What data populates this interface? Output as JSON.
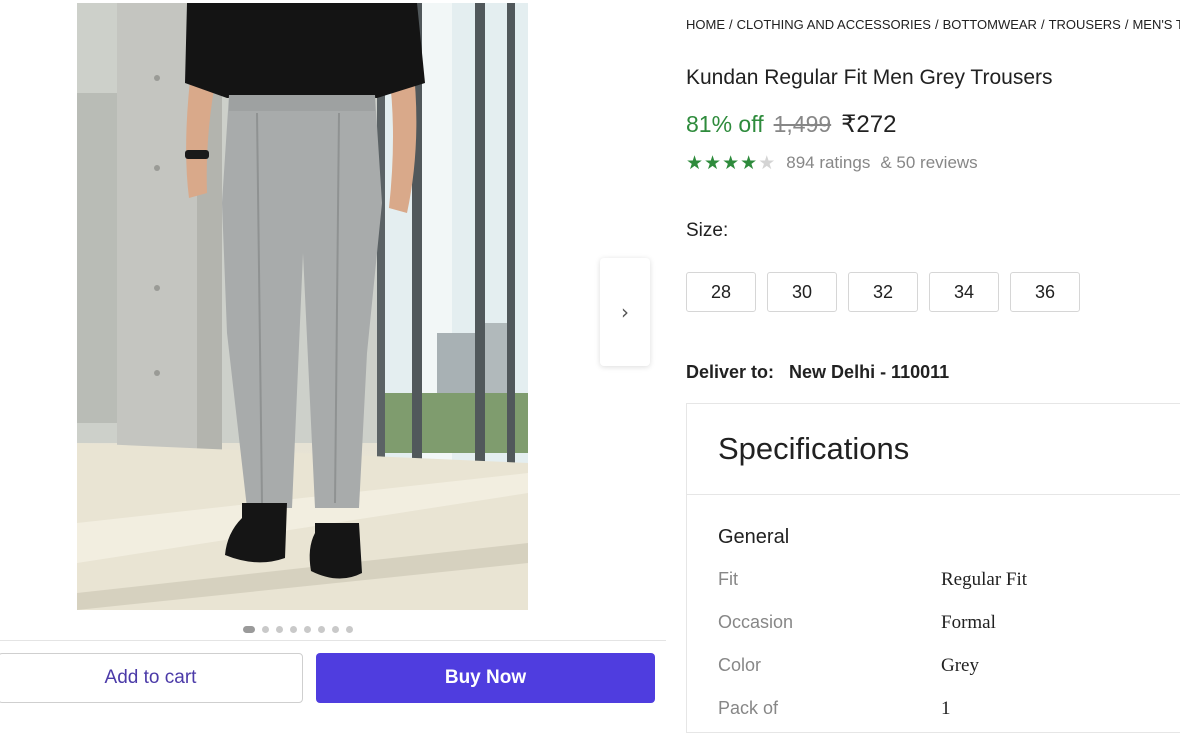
{
  "breadcrumb": [
    "HOME",
    "CLOTHING AND ACCESSORIES",
    "BOTTOMWEAR",
    "TROUSERS",
    "MEN'S TROUSERS"
  ],
  "breadcrumb_separator": "/",
  "product": {
    "title": "Kundan Regular Fit Men Grey Trousers",
    "discount": "81% off",
    "mrp": "1,499",
    "price": "₹272",
    "rating_stars": 4,
    "ratings_text": "894 ratings",
    "reviews_text": "& 50 reviews"
  },
  "image_carousel": {
    "total_dots": 8,
    "active_index": 0,
    "next_icon": "chevron-right-icon"
  },
  "size": {
    "label": "Size:",
    "options": [
      "28",
      "30",
      "32",
      "34",
      "36"
    ]
  },
  "delivery": {
    "label": "Deliver to:",
    "location": "New Delhi - 110011"
  },
  "specifications": {
    "title": "Specifications",
    "group": "General",
    "rows": [
      {
        "key": "Fit",
        "value": "Regular Fit"
      },
      {
        "key": "Occasion",
        "value": "Formal"
      },
      {
        "key": "Color",
        "value": "Grey"
      },
      {
        "key": "Pack of",
        "value": "1"
      }
    ]
  },
  "actions": {
    "add_to_cart": "Add to cart",
    "buy_now": "Buy Now"
  },
  "colors": {
    "discount_green": "#2e8b3c",
    "buy_button": "#4f3ddf",
    "cart_text": "#4b3aa8"
  }
}
